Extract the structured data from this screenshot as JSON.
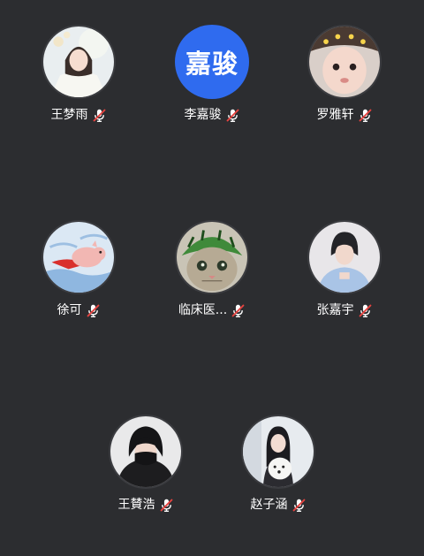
{
  "colors": {
    "background": "#2c2d30",
    "name_text": "#ffffff",
    "mute_icon": "#ffffff",
    "mute_slash": "#e64340",
    "text_avatar_bg": "#2f6bef"
  },
  "participants": [
    {
      "name": "王梦雨",
      "avatar": "photo",
      "avatar_text": "",
      "muted": true
    },
    {
      "name": "李嘉骏",
      "avatar": "text",
      "avatar_text": "嘉骏",
      "muted": true
    },
    {
      "name": "罗雅轩",
      "avatar": "photo",
      "avatar_text": "",
      "muted": true
    },
    {
      "name": "徐可",
      "avatar": "photo",
      "avatar_text": "",
      "muted": true
    },
    {
      "name": "临床医...",
      "avatar": "photo",
      "avatar_text": "",
      "muted": true
    },
    {
      "name": "张嘉宇",
      "avatar": "photo",
      "avatar_text": "",
      "muted": true
    },
    {
      "name": "王賛浩",
      "avatar": "photo",
      "avatar_text": "",
      "muted": true
    },
    {
      "name": "赵子涵",
      "avatar": "photo",
      "avatar_text": "",
      "muted": true
    }
  ],
  "icons": {
    "mute": "mic-muted-icon"
  }
}
